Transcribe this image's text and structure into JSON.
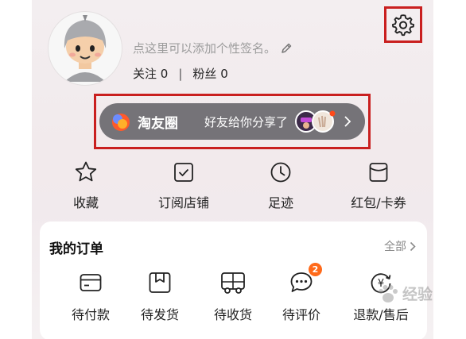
{
  "profile": {
    "signature": "点这里可以添加个性签名。",
    "follow_label": "关注",
    "follow_count": "0",
    "separator": "|",
    "fans_label": "粉丝",
    "fans_count": "0"
  },
  "circle_banner": {
    "title": "淘友圈",
    "message": "好友给你分享了"
  },
  "shortcuts": [
    {
      "label": "收藏",
      "icon": "star-icon"
    },
    {
      "label": "订阅店铺",
      "icon": "store-check-icon"
    },
    {
      "label": "足迹",
      "icon": "clock-icon"
    },
    {
      "label": "红包/卡券",
      "icon": "red-envelope-icon"
    }
  ],
  "orders": {
    "title": "我的订单",
    "all_label": "全部",
    "items": [
      {
        "label": "待付款",
        "icon": "wallet-icon"
      },
      {
        "label": "待发货",
        "icon": "package-icon"
      },
      {
        "label": "待收货",
        "icon": "truck-icon"
      },
      {
        "label": "待评价",
        "icon": "chat-icon",
        "badge": "2"
      },
      {
        "label": "退款/售后",
        "icon": "refund-icon"
      }
    ]
  },
  "watermark": "经验",
  "colors": {
    "highlight_border": "#c91f1f",
    "badge": "#ff6a1a",
    "banner_pill": "#757378"
  }
}
